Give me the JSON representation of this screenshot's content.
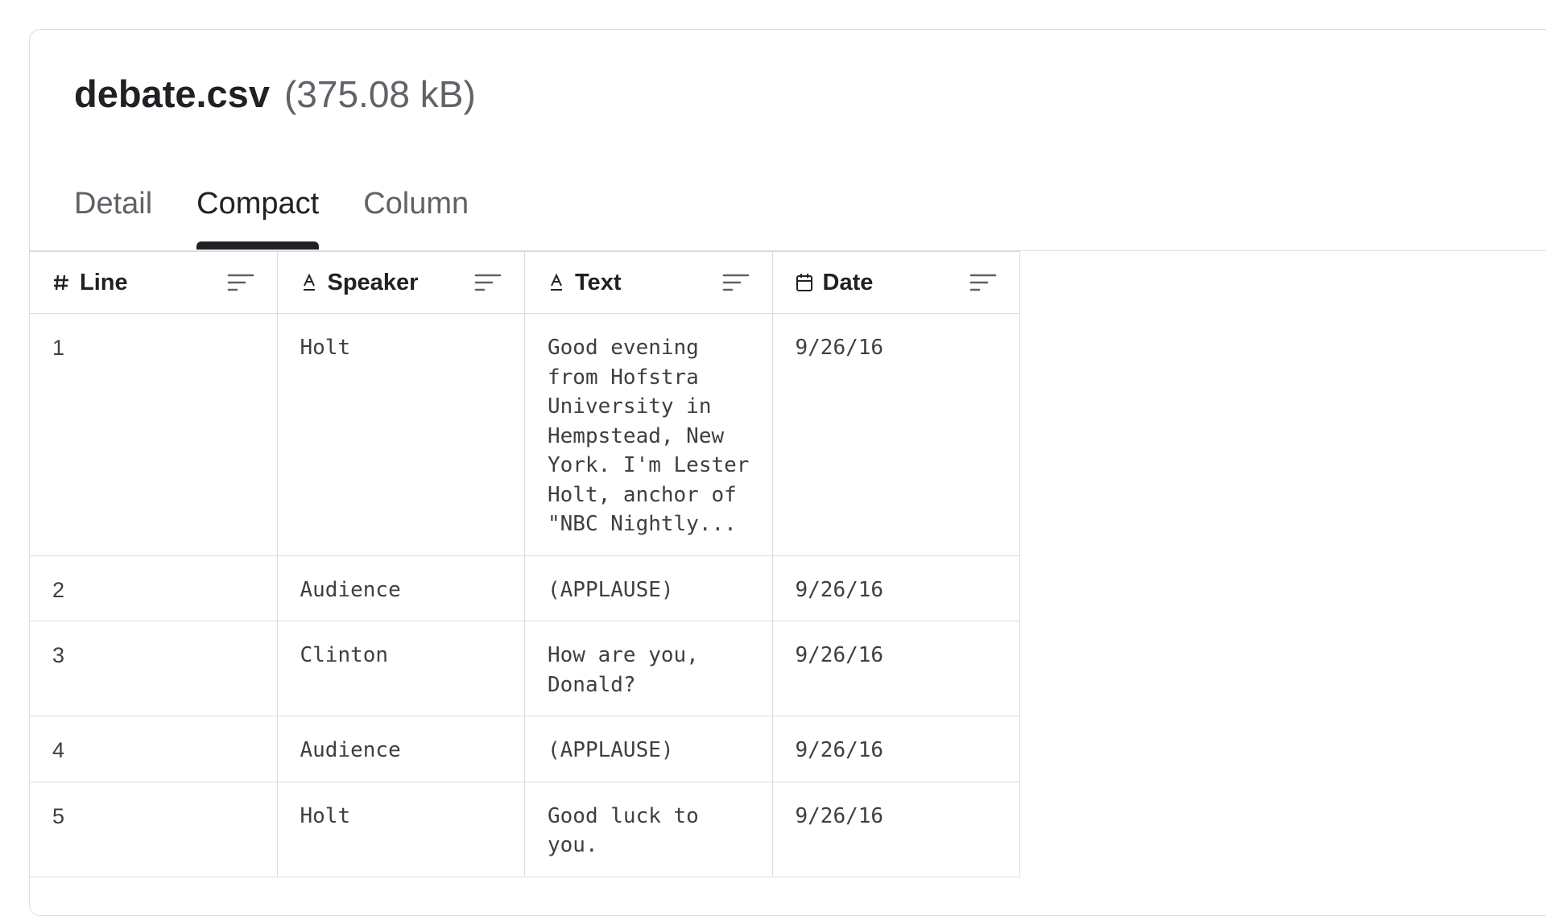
{
  "file": {
    "name": "debate.csv",
    "size": "(375.08 kB)"
  },
  "tabs": [
    {
      "label": "Detail",
      "active": false
    },
    {
      "label": "Compact",
      "active": true
    },
    {
      "label": "Column",
      "active": false
    }
  ],
  "table": {
    "columns": [
      {
        "label": "Line",
        "type_icon": "hash-icon",
        "type_glyph": "#"
      },
      {
        "label": "Speaker",
        "type_icon": "text-type-icon",
        "type_glyph": "A"
      },
      {
        "label": "Text",
        "type_icon": "text-type-icon",
        "type_glyph": "A"
      },
      {
        "label": "Date",
        "type_icon": "calendar-icon",
        "type_glyph": ""
      }
    ],
    "rows": [
      {
        "line": "1",
        "speaker": "Holt",
        "text": "Good evening from Hofstra University in Hempstead, New York. I'm Lester Holt, anchor of \"NBC Nightly...",
        "date": "9/26/16"
      },
      {
        "line": "2",
        "speaker": "Audience",
        "text": "(APPLAUSE)",
        "date": "9/26/16"
      },
      {
        "line": "3",
        "speaker": "Clinton",
        "text": "How are you, Donald?",
        "date": "9/26/16"
      },
      {
        "line": "4",
        "speaker": "Audience",
        "text": "(APPLAUSE)",
        "date": "9/26/16"
      },
      {
        "line": "5",
        "speaker": "Holt",
        "text": "Good luck to you.",
        "date": "9/26/16"
      }
    ]
  },
  "colors": {
    "text_primary": "#202124",
    "text_secondary": "#5f6368",
    "border": "#dadce0",
    "active_indicator": "#202124"
  }
}
